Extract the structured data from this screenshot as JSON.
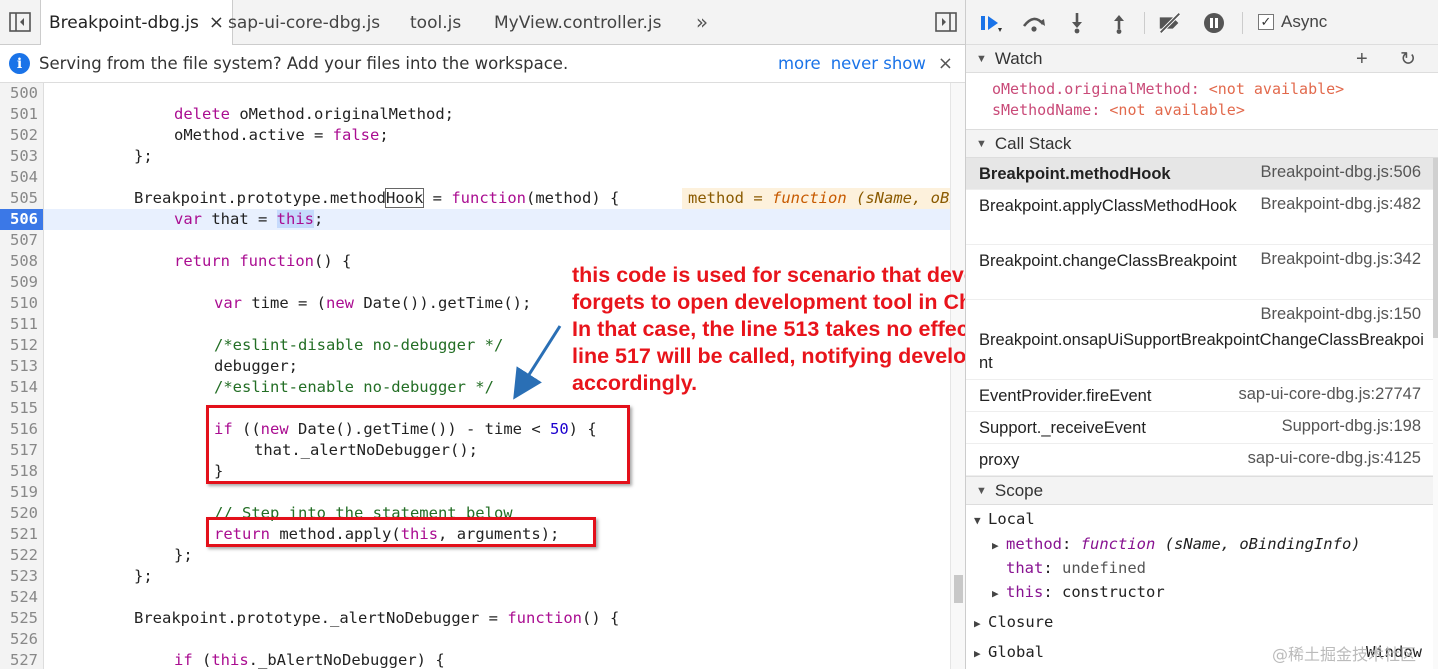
{
  "tabs": [
    {
      "label": "Breakpoint-dbg.js",
      "active": true,
      "closable": true
    },
    {
      "label": "sap-ui-core-dbg.js",
      "active": false
    },
    {
      "label": "tool.js",
      "active": false
    },
    {
      "label": "MyView.controller.js",
      "active": false
    }
  ],
  "tab_overflow": "»",
  "infobar": {
    "message": "Serving from the file system? Add your files into the workspace.",
    "link_more": "more",
    "link_never": "never show",
    "close": "×"
  },
  "code_lines": [
    {
      "n": "500",
      "t": ""
    },
    {
      "n": "501",
      "t": "delete oMethod.originalMethod;"
    },
    {
      "n": "502",
      "t": "oMethod.active = false;"
    },
    {
      "n": "503",
      "t": "};"
    },
    {
      "n": "504",
      "t": ""
    },
    {
      "n": "505",
      "t": "Breakpoint.prototype.methodHook = function(method) {",
      "inline": "method = function (sName, oBi"
    },
    {
      "n": "506",
      "t": "var that = this;",
      "current": true
    },
    {
      "n": "507",
      "t": ""
    },
    {
      "n": "508",
      "t": "return function() {"
    },
    {
      "n": "509",
      "t": ""
    },
    {
      "n": "510",
      "t": "var time = (new Date()).getTime();"
    },
    {
      "n": "511",
      "t": ""
    },
    {
      "n": "512",
      "t": "/*eslint-disable no-debugger */"
    },
    {
      "n": "513",
      "t": "debugger;"
    },
    {
      "n": "514",
      "t": "/*eslint-enable no-debugger */"
    },
    {
      "n": "515",
      "t": ""
    },
    {
      "n": "516",
      "t": "if ((new Date().getTime()) - time < 50) {"
    },
    {
      "n": "517",
      "t": "that._alertNoDebugger();"
    },
    {
      "n": "518",
      "t": "}"
    },
    {
      "n": "519",
      "t": ""
    },
    {
      "n": "520",
      "t": "// Step into the statement below"
    },
    {
      "n": "521",
      "t": "return method.apply(this, arguments);"
    },
    {
      "n": "522",
      "t": "};"
    },
    {
      "n": "523",
      "t": "};"
    },
    {
      "n": "524",
      "t": ""
    },
    {
      "n": "525",
      "t": "Breakpoint.prototype._alertNoDebugger = function() {"
    },
    {
      "n": "526",
      "t": ""
    },
    {
      "n": "527",
      "t": "if (this._bAlertNoDebugger) {"
    }
  ],
  "annotation": "this code is used for scenario that developer forgets to open development tool in Chrome. In that case, the line 513 takes no effect so line 517 will be called, notifying developer accordingly.",
  "debugger": {
    "async_label": "Async",
    "async_checked": true
  },
  "watch": {
    "title": "Watch",
    "items": [
      {
        "expr": "oMethod.originalMethod",
        "value": "<not available>"
      },
      {
        "expr": "sMethodName",
        "value": "<not available>"
      }
    ]
  },
  "call_stack": {
    "title": "Call Stack",
    "frames": [
      {
        "fn": "Breakpoint.methodHook",
        "loc": "Breakpoint-dbg.js:506",
        "active": true
      },
      {
        "fn": "Breakpoint.applyClassMethodHook",
        "loc": "Breakpoint-dbg.js:482"
      },
      {
        "fn": "Breakpoint.changeClassBreakpoint",
        "loc": "Breakpoint-dbg.js:342"
      },
      {
        "fn": "Breakpoint.onsapUiSupportBreakpointChangeClassBreakpoint",
        "loc": "Breakpoint-dbg.js:150"
      },
      {
        "fn": "EventProvider.fireEvent",
        "loc": "sap-ui-core-dbg.js:27747"
      },
      {
        "fn": "Support._receiveEvent",
        "loc": "Support-dbg.js:198"
      },
      {
        "fn": "proxy",
        "loc": "sap-ui-core-dbg.js:4125"
      }
    ]
  },
  "scope": {
    "title": "Scope",
    "local_label": "Local",
    "vars": [
      {
        "name": "method",
        "sep": ": ",
        "value": "function",
        "extra": " (sName, oBindingInfo)"
      },
      {
        "name": "that",
        "sep": ": ",
        "value": "undefined"
      },
      {
        "name": "this",
        "sep": ": ",
        "value": "constructor"
      }
    ],
    "closure_label": "Closure",
    "global_label": "Global",
    "global_value": "Window"
  },
  "watermark": "@稀土掘金技术社区",
  "colors": {
    "accent": "#1a73e8",
    "current_line": "#3b78e7",
    "annotation_red": "#e3101a"
  }
}
